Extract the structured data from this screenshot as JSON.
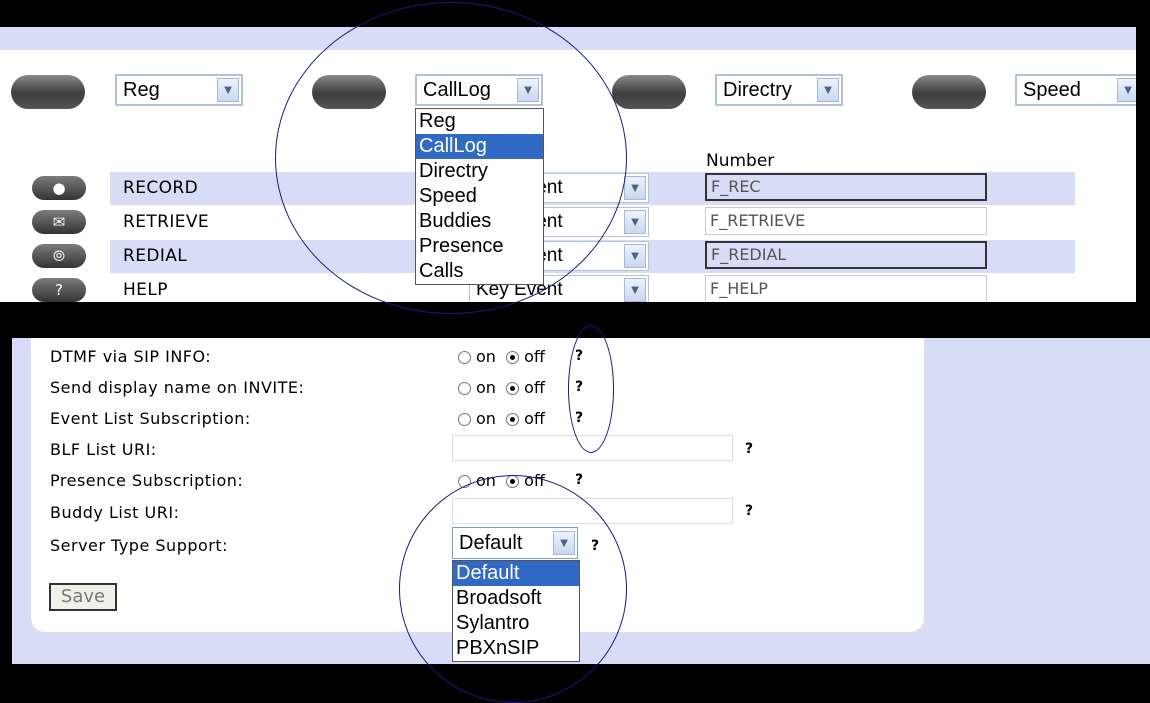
{
  "accent_colors": {
    "band": "#d7ddf7",
    "selected": "#316ac5",
    "annotation": "#1a1a7e"
  },
  "top_panel": {
    "softkey_selects": [
      {
        "value": "Reg"
      },
      {
        "value": "CallLog"
      },
      {
        "value": "Directry"
      },
      {
        "value": "Speed"
      }
    ],
    "calllog_dropdown": {
      "options": [
        "Reg",
        "CallLog",
        "Directry",
        "Speed",
        "Buddies",
        "Presence",
        "Calls"
      ],
      "selected": "CallLog"
    },
    "number_header": "Number",
    "rows": [
      {
        "icon": "record-icon",
        "label": "RECORD",
        "event": "Key Event",
        "number": "F_REC"
      },
      {
        "icon": "mail-icon",
        "label": "RETRIEVE",
        "event": "Key Event",
        "number": "F_RETRIEVE"
      },
      {
        "icon": "redial-icon",
        "label": "REDIAL",
        "event": "Key Event",
        "number": "F_REDIAL"
      },
      {
        "icon": "help-icon",
        "label": "HELP",
        "event": "Key Event",
        "number": "F_HELP"
      }
    ]
  },
  "bottom_panel": {
    "fields": [
      {
        "label": "DTMF via SIP INFO:",
        "type": "radio",
        "on": "on",
        "off": "off",
        "value": "off"
      },
      {
        "label": "Send display name on INVITE:",
        "type": "radio",
        "on": "on",
        "off": "off",
        "value": "off"
      },
      {
        "label": "Event List Subscription:",
        "type": "radio",
        "on": "on",
        "off": "off",
        "value": "off"
      },
      {
        "label": "BLF List URI:",
        "type": "text",
        "value": ""
      },
      {
        "label": "Presence Subscription:",
        "type": "radio",
        "on": "on",
        "off": "off",
        "value": "off"
      },
      {
        "label": "Buddy List URI:",
        "type": "text",
        "value": ""
      },
      {
        "label": "Server Type Support:",
        "type": "select",
        "value": "Default"
      }
    ],
    "help_mark": "?",
    "server_dropdown": {
      "options": [
        "Default",
        "Broadsoft",
        "Sylantro",
        "PBXnSIP"
      ],
      "selected": "Default"
    },
    "save_label": "Save"
  }
}
